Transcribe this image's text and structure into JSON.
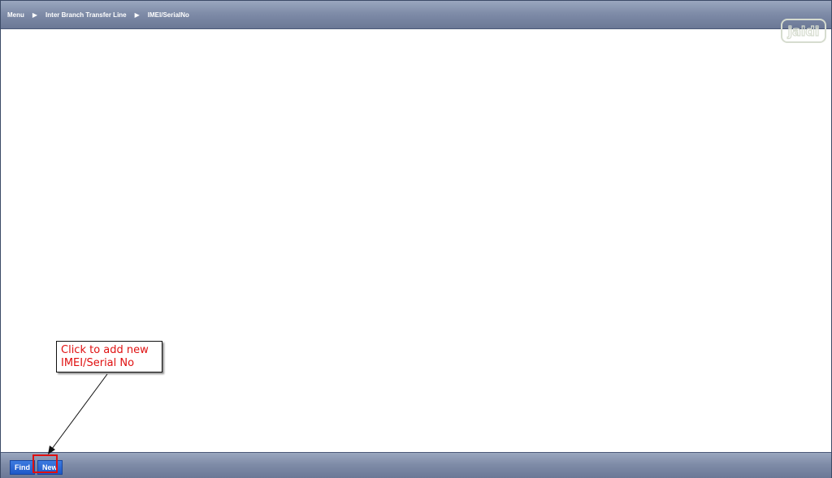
{
  "breadcrumb": {
    "items": [
      "Menu",
      "Inter Branch Transfer Line",
      "IMEI/SerialNo"
    ],
    "separator": "▶"
  },
  "logo": {
    "text": "jaldi"
  },
  "toolbar": {
    "find_label": "Find",
    "new_label": "New"
  },
  "annotation": {
    "line1": "Click to add new",
    "line2": "IMEI/Serial No",
    "color": "#e01010"
  }
}
